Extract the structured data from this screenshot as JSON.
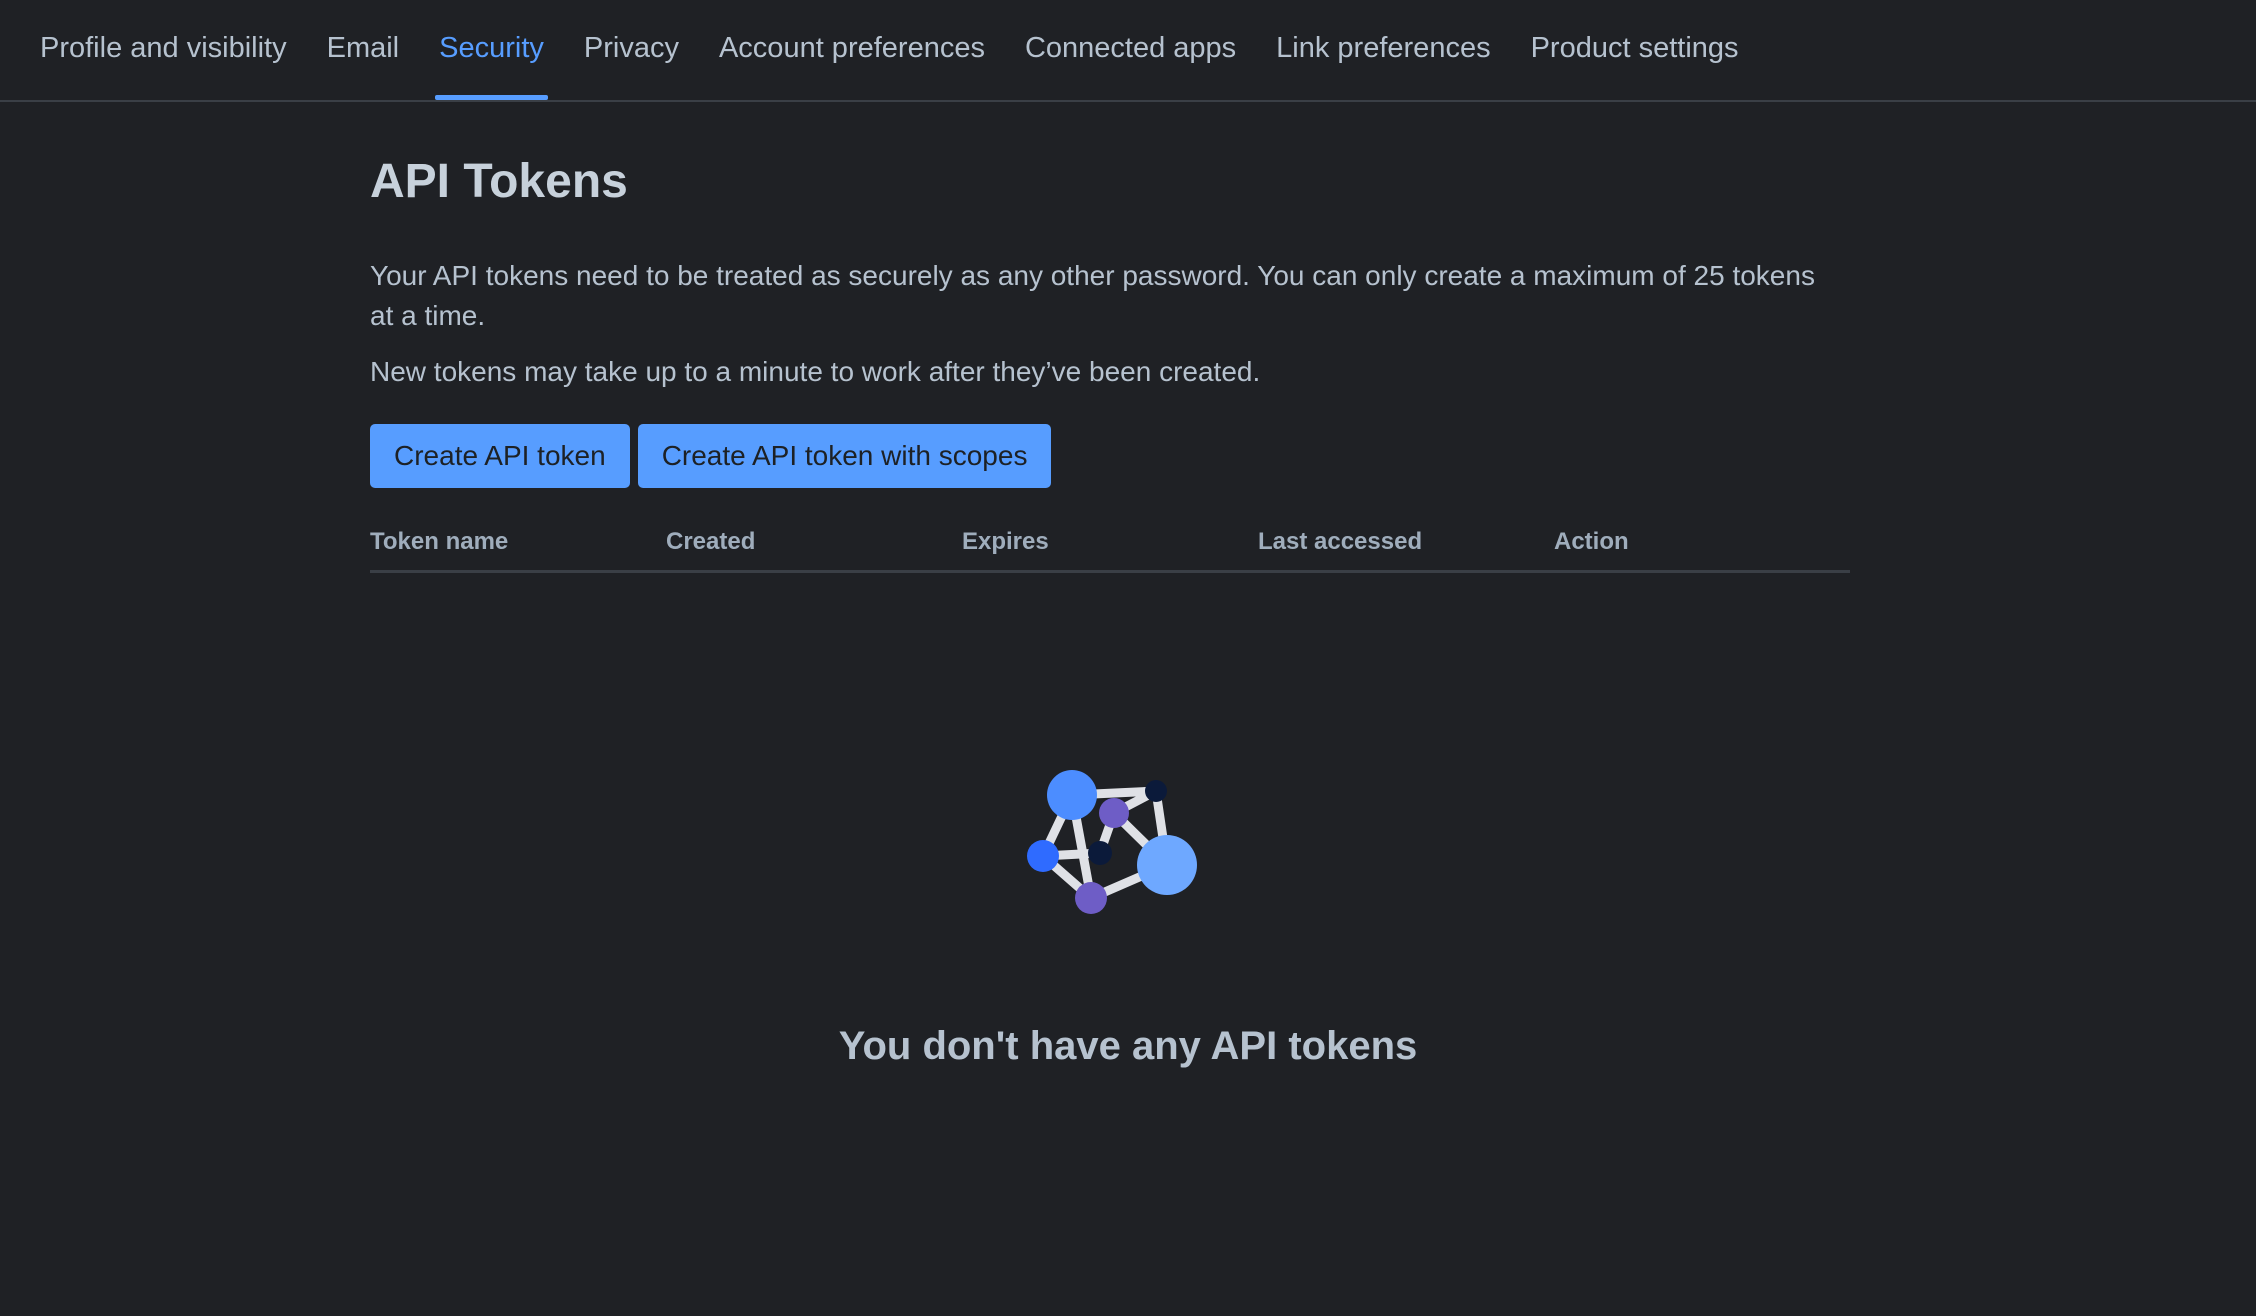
{
  "nav": {
    "tabs": [
      {
        "label": "Profile and visibility"
      },
      {
        "label": "Email"
      },
      {
        "label": "Security",
        "active": true
      },
      {
        "label": "Privacy"
      },
      {
        "label": "Account preferences"
      },
      {
        "label": "Connected apps"
      },
      {
        "label": "Link preferences"
      },
      {
        "label": "Product settings"
      }
    ]
  },
  "main": {
    "title": "API Tokens",
    "description": "Your API tokens need to be treated as securely as any other password. You can only create a maximum of 25 tokens at a time.",
    "note": "New tokens may take up to a minute to work after they’ve been created.",
    "buttons": {
      "create": "Create API token",
      "create_scopes": "Create API token with scopes"
    },
    "table": {
      "columns": [
        "Token name",
        "Created",
        "Expires",
        "Last accessed",
        "Action"
      ]
    },
    "empty_state": {
      "illustration": "network-nodes-icon",
      "message": "You don't have any API tokens"
    }
  },
  "colors": {
    "background": "#1f2125",
    "accent": "#579dff",
    "text": "#c7d1db",
    "muted": "#9fadbc",
    "divider": "#3a3f46"
  }
}
